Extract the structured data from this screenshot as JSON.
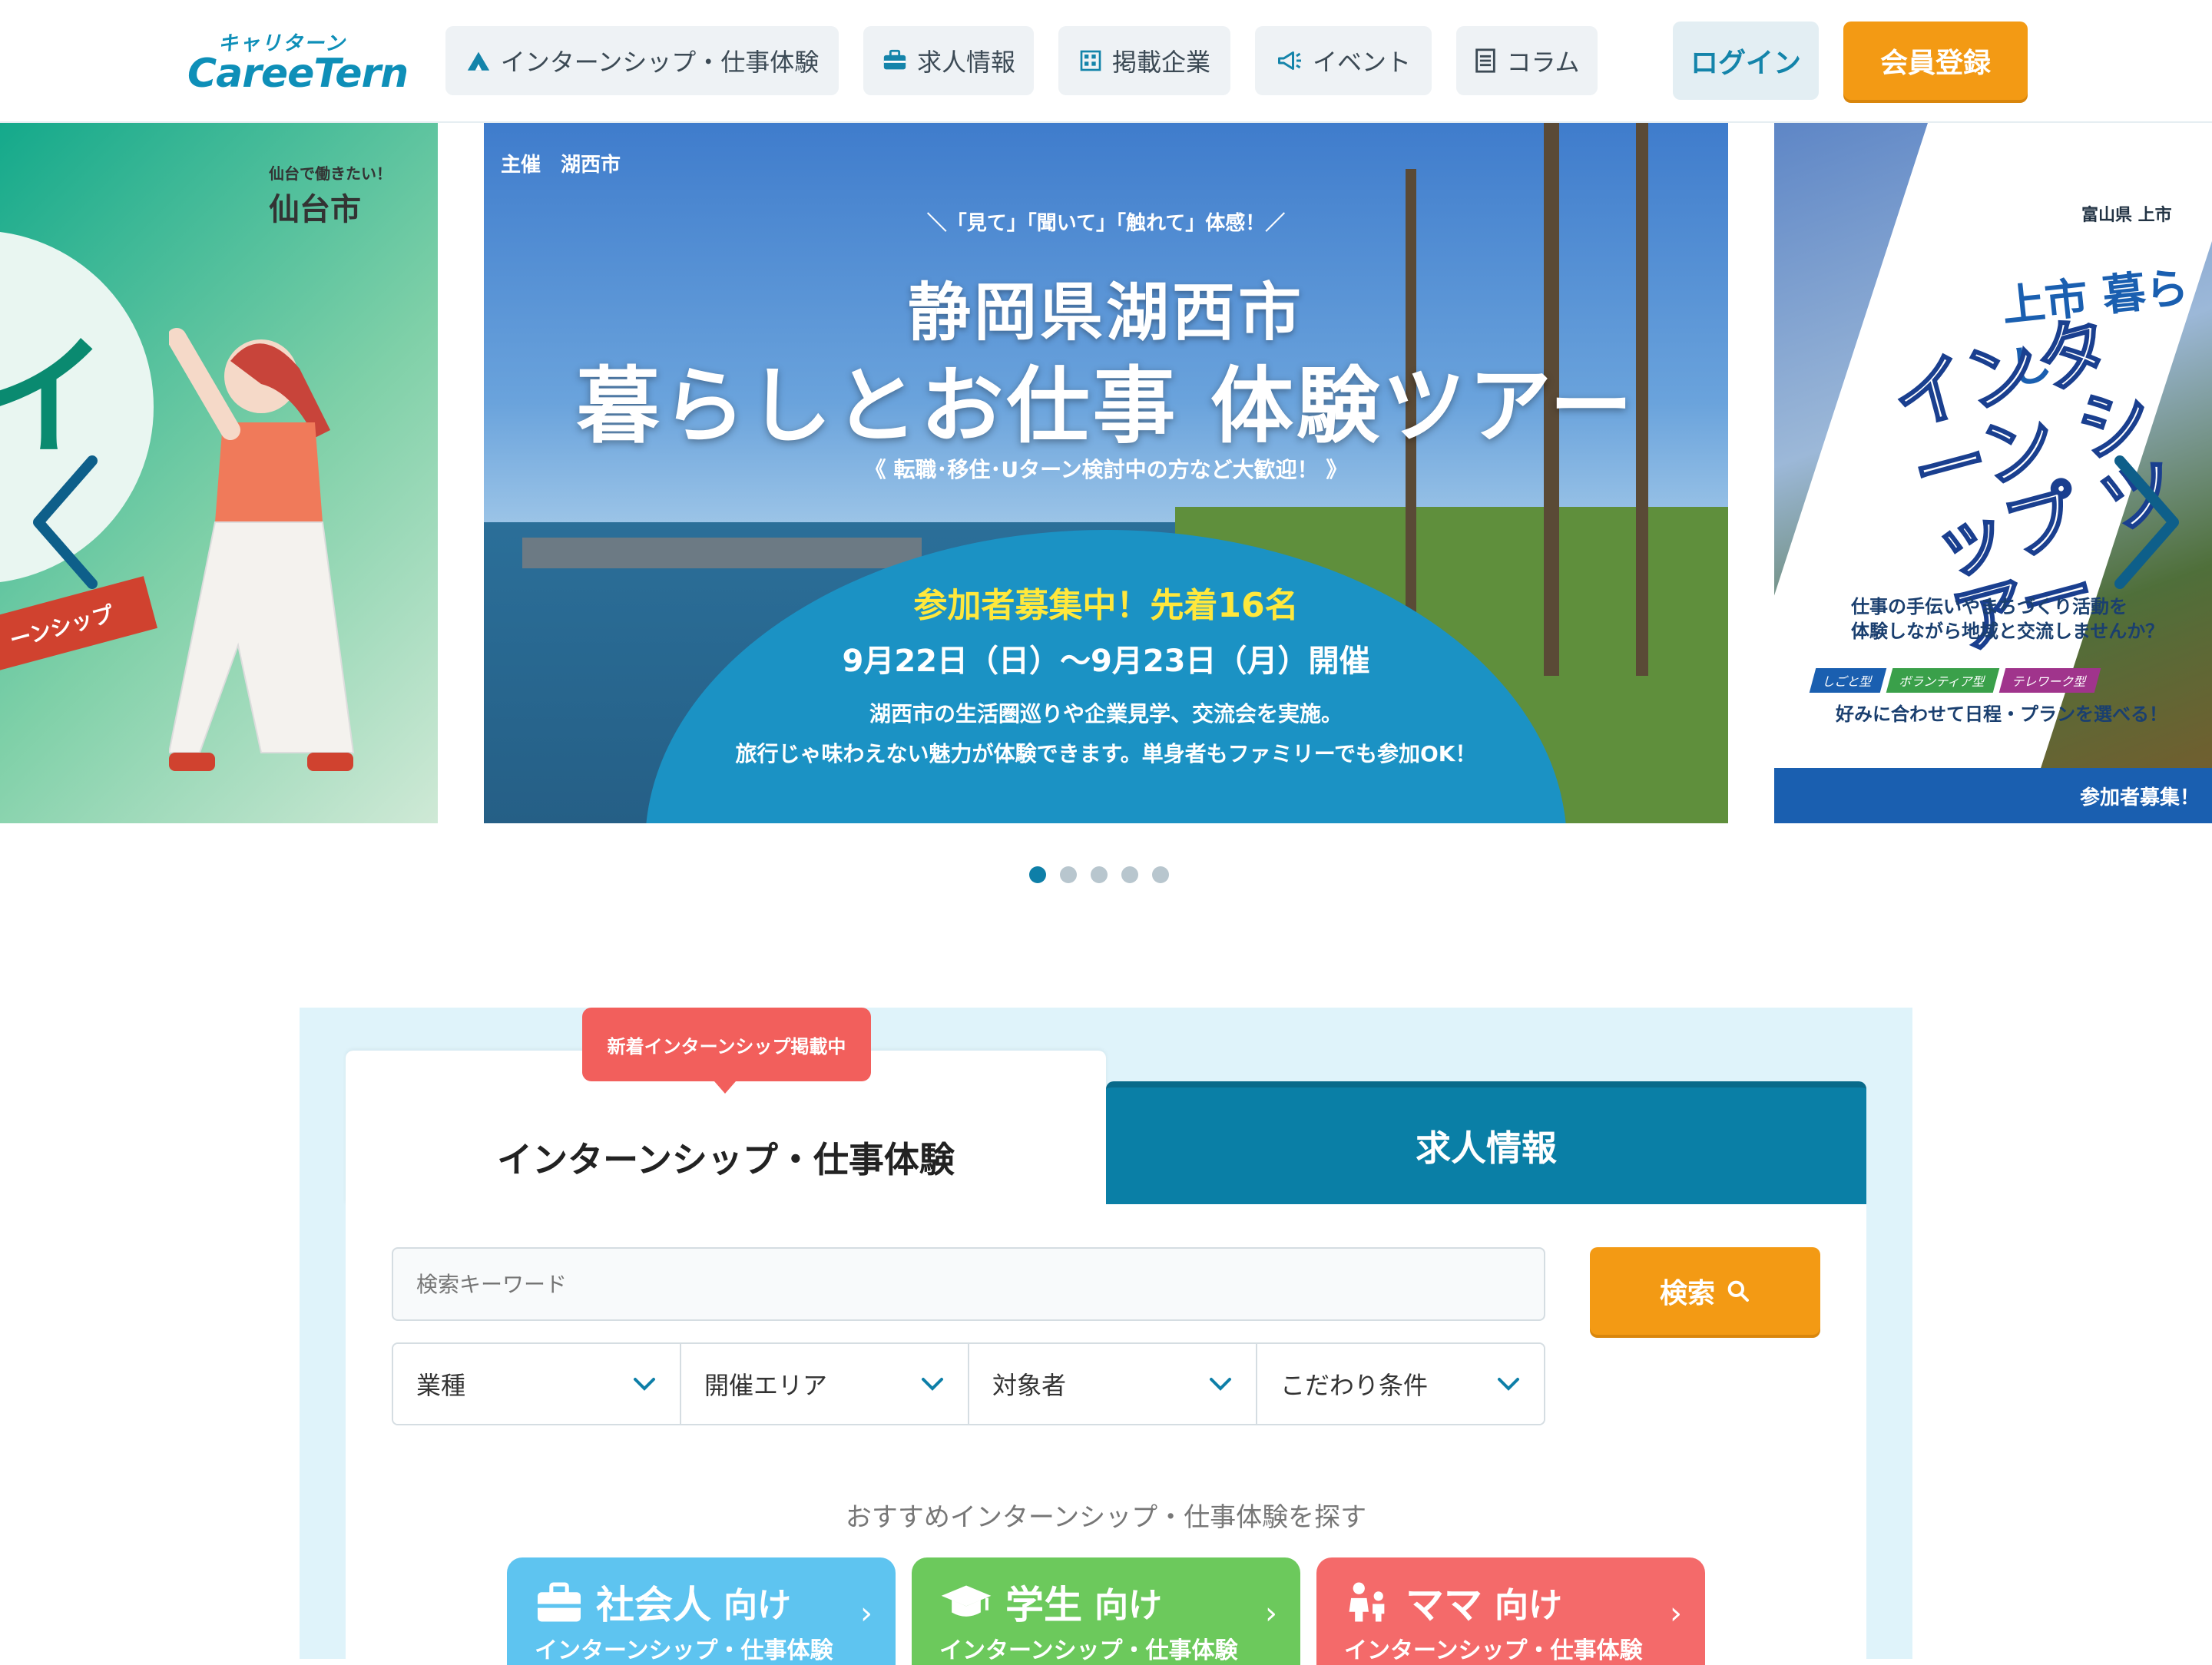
{
  "header": {
    "logo_kana": "キャリターン",
    "logo_text": "CareeTern",
    "nav": [
      {
        "label": "インターンシップ・仕事体験",
        "icon": "mountain-icon"
      },
      {
        "label": "求人情報",
        "icon": "briefcase-icon"
      },
      {
        "label": "掲載企業",
        "icon": "building-icon"
      },
      {
        "label": "イベント",
        "icon": "megaphone-icon"
      },
      {
        "label": "コラム",
        "icon": "document-icon"
      }
    ],
    "login_label": "ログイン",
    "register_label": "会員登録"
  },
  "carousel": {
    "left_slide": {
      "sub": "仙台で働きたい！",
      "city": "仙台市",
      "big": "イ",
      "ribbon": "ーンシップ"
    },
    "center_slide": {
      "host": "主催　湖西市",
      "catch": "＼「見て」「聞いて」「触れて」体感！／",
      "title1": "静岡県湖西市",
      "title2": "暮らしとお仕事 体験ツアー",
      "welcome": "《 転職･移住･Uターン検討中の方など大歓迎！ 》",
      "recruit": "参加者募集中！先着16名",
      "date": "9月22日（日）～9月23日（月）開催",
      "desc1": "湖西市の生活圏巡りや企業見学、交流会を実施。",
      "desc2": "旅行じゃ味わえない魅力が体験できます。単身者もファミリーでも参加OK！"
    },
    "right_slide": {
      "logo": "富山県 上市",
      "title1": "上市 暮らし",
      "title2": "インターン シップ ツアー",
      "text1": "仕事の手伝いやまちづくり活動を",
      "text2": "体験しながら地域と交流しませんか？",
      "tags": [
        "しごと型",
        "ボランティア型",
        "テレワーク型"
      ],
      "pick": "好みに合わせて日程・プランを選べる！",
      "bar": "参加者募集！"
    },
    "dots_count": 5,
    "active_dot": 0
  },
  "search": {
    "badge": "新着インターンシップ掲載中",
    "tab_active": "インターンシップ・仕事体験",
    "tab_inactive": "求人情報",
    "placeholder": "検索キーワード",
    "search_label": "検索",
    "filters": [
      "業種",
      "開催エリア",
      "対象者",
      "こだわり条件"
    ],
    "recommend_title": "おすすめインターンシップ・仕事体験を探す",
    "categories": [
      {
        "main": "社会人",
        "suffix": "向け",
        "sub": "インターンシップ・仕事体験",
        "color": "#5ec4f0",
        "icon": "briefcase-icon"
      },
      {
        "main": "学生",
        "suffix": "向け",
        "sub": "インターンシップ・仕事体験",
        "color": "#6cc95c",
        "icon": "graduation-cap-icon"
      },
      {
        "main": "ママ",
        "suffix": "向け",
        "sub": "インターンシップ・仕事体験",
        "color": "#f46a6a",
        "icon": "family-icon"
      }
    ]
  },
  "colors": {
    "primary": "#0e7fa8",
    "accent": "#f39a14",
    "badge": "#f25f5c",
    "section_bg": "#dff3fa"
  }
}
